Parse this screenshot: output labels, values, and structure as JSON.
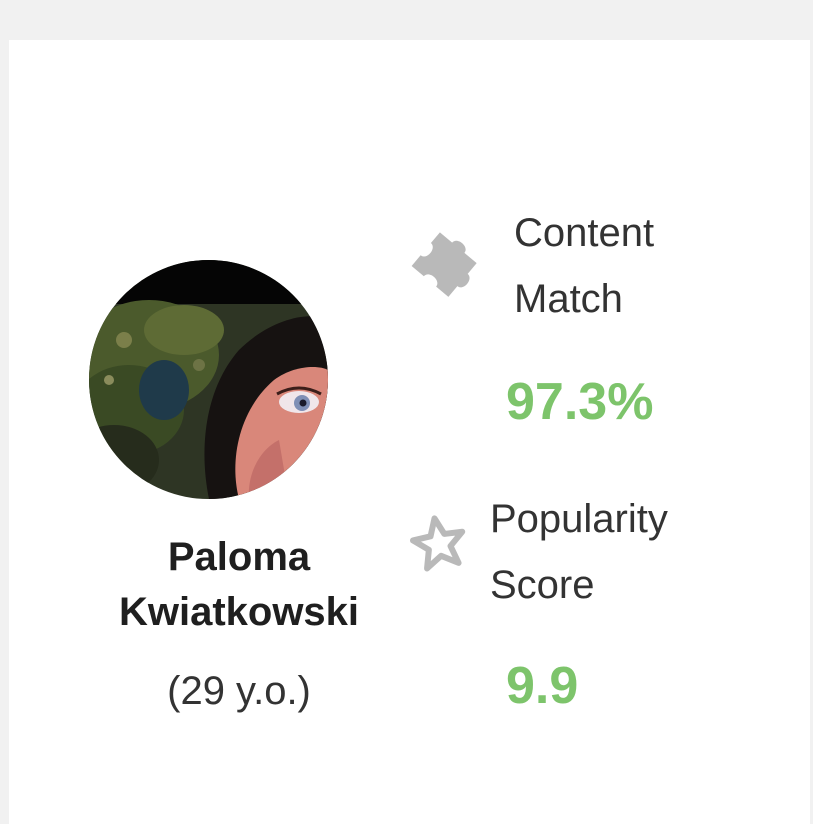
{
  "profile": {
    "first_name": "Paloma",
    "last_name": "Kwiatkowski",
    "age_text": "(29 y.o.)"
  },
  "metrics": {
    "content_match": {
      "icon": "puzzle-piece-icon",
      "label_line1": "Content",
      "label_line2": "Match",
      "value": "97.3%"
    },
    "popularity": {
      "icon": "star-outline-icon",
      "label_line1": "Popularity",
      "label_line2": "Score",
      "value": "9.9"
    }
  },
  "colors": {
    "value_green": "#7dc46b",
    "icon_gray": "#b9b9b9",
    "text_dark": "#333333"
  }
}
